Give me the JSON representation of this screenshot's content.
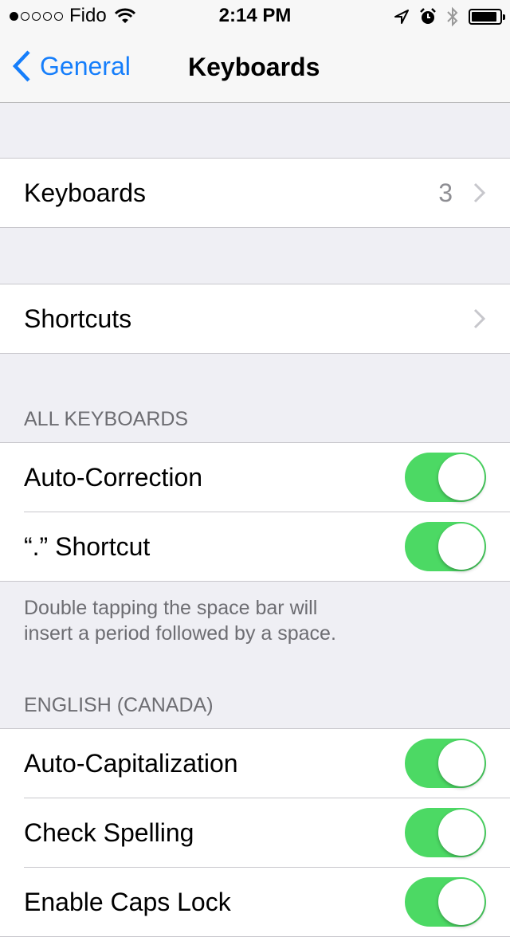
{
  "status_bar": {
    "carrier": "Fido",
    "signal_bars_filled": 1,
    "signal_bars_total": 5,
    "time": "2:14 PM",
    "icons": [
      "wifi-icon",
      "location-icon",
      "alarm-icon",
      "bluetooth-icon",
      "battery-icon"
    ],
    "battery_level": 0.92
  },
  "nav": {
    "back_label": "General",
    "title": "Keyboards"
  },
  "sections": {
    "keyboards_row": {
      "label": "Keyboards",
      "value": "3"
    },
    "shortcuts_row": {
      "label": "Shortcuts"
    },
    "all_keyboards": {
      "header": "ALL KEYBOARDS",
      "rows": [
        {
          "label": "Auto-Correction",
          "on": true
        },
        {
          "label": "“.” Shortcut",
          "on": true
        }
      ],
      "footer_line1": "Double tapping the space bar will",
      "footer_line2": "insert a period followed by a space."
    },
    "english_canada": {
      "header": "ENGLISH (CANADA)",
      "rows": [
        {
          "label": "Auto-Capitalization",
          "on": true
        },
        {
          "label": "Check Spelling",
          "on": true
        },
        {
          "label": "Enable Caps Lock",
          "on": true
        }
      ]
    }
  },
  "colors": {
    "accent": "#157efb",
    "toggle_on": "#4cd964",
    "background": "#efeff4"
  }
}
